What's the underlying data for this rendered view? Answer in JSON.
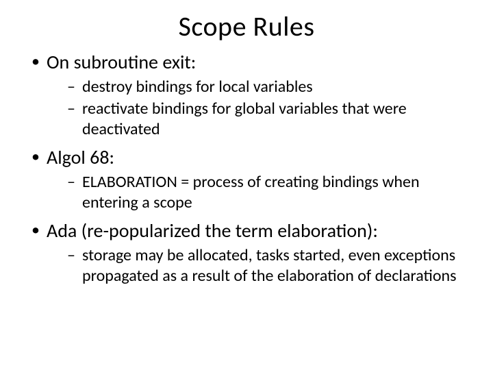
{
  "title": "Scope Rules",
  "bullets": [
    {
      "text": "On subroutine exit:",
      "sub": [
        "destroy bindings for local variables",
        "reactivate bindings for global variables that were deactivated"
      ]
    },
    {
      "text": "Algol 68:",
      "sub": [
        "ELABORATION = process of creating bindings when entering a scope"
      ]
    },
    {
      "text": "Ada (re-popularized the term elaboration):",
      "sub": [
        "storage may be allocated, tasks started, even exceptions propagated as a result of the elaboration of declarations"
      ]
    }
  ]
}
